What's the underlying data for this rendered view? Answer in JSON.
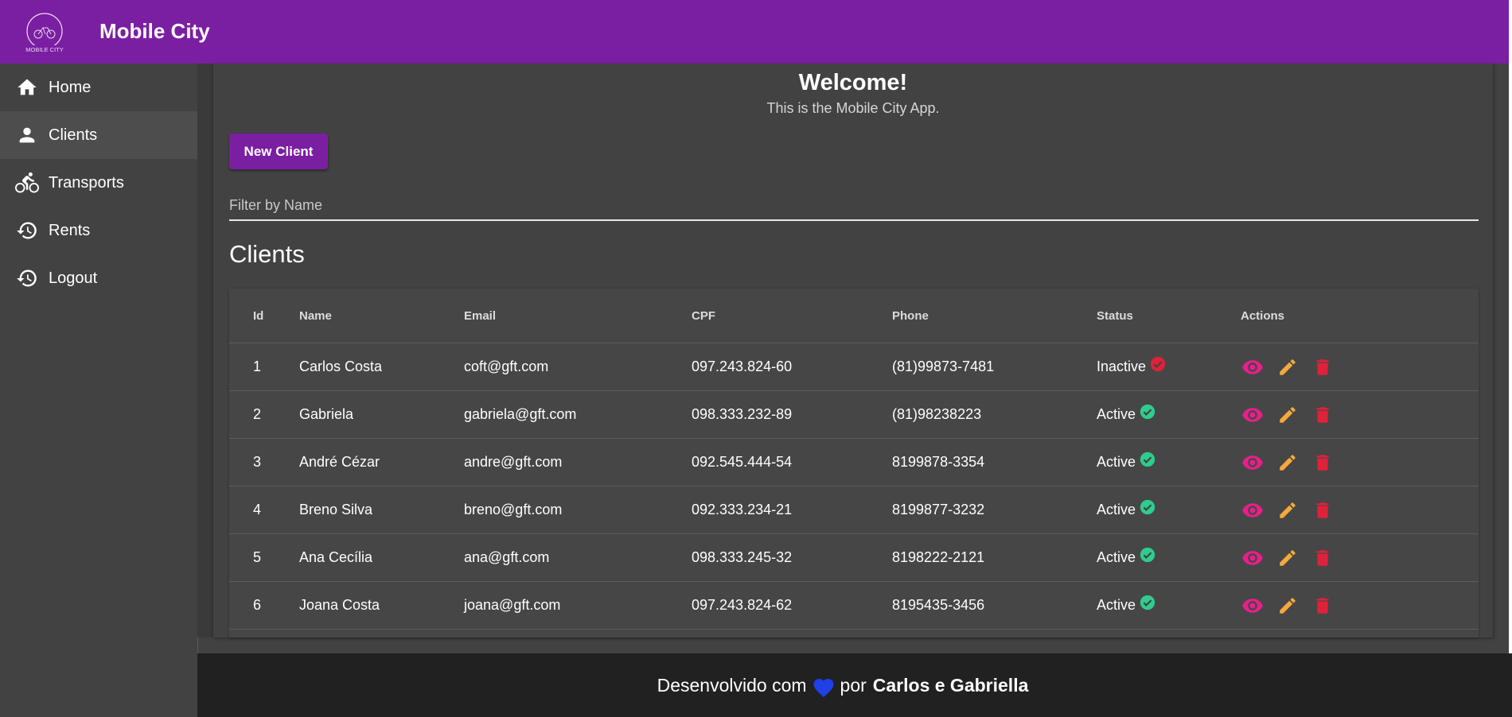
{
  "app": {
    "title": "Mobile City",
    "logo_text": "MOBILE CITY"
  },
  "sidebar": {
    "items": [
      {
        "label": "Home",
        "icon": "home-icon"
      },
      {
        "label": "Clients",
        "icon": "person-icon",
        "active": true
      },
      {
        "label": "Transports",
        "icon": "bicycle-icon"
      },
      {
        "label": "Rents",
        "icon": "history-icon"
      },
      {
        "label": "Logout",
        "icon": "history-icon"
      }
    ]
  },
  "main": {
    "welcome_title": "Welcome!",
    "welcome_subtitle": "This is the Mobile City App.",
    "new_client_label": "New Client",
    "filter_placeholder": "Filter by Name",
    "section_title": "Clients"
  },
  "table": {
    "headers": [
      "Id",
      "Name",
      "Email",
      "CPF",
      "Phone",
      "Status",
      "Actions"
    ],
    "rows": [
      {
        "id": "1",
        "name": "Carlos Costa",
        "email": "coft@gft.com",
        "cpf": "097.243.824-60",
        "phone": "(81)99873-7481",
        "status": "Inactive"
      },
      {
        "id": "2",
        "name": "Gabriela",
        "email": "gabriela@gft.com",
        "cpf": "098.333.232-89",
        "phone": "(81)98238223",
        "status": "Active"
      },
      {
        "id": "3",
        "name": "André Cézar",
        "email": "andre@gft.com",
        "cpf": "092.545.444-54",
        "phone": "8199878-3354",
        "status": "Active"
      },
      {
        "id": "4",
        "name": "Breno Silva",
        "email": "breno@gft.com",
        "cpf": "092.333.234-21",
        "phone": "8199877-3232",
        "status": "Active"
      },
      {
        "id": "5",
        "name": "Ana Cecília",
        "email": "ana@gft.com",
        "cpf": "098.333.245-32",
        "phone": "8198222-2121",
        "status": "Active"
      },
      {
        "id": "6",
        "name": "Joana Costa",
        "email": "joana@gft.com",
        "cpf": "097.243.824-62",
        "phone": "8195435-3456",
        "status": "Active"
      }
    ]
  },
  "footer": {
    "prefix": "Desenvolvido com",
    "middle": "por",
    "authors": "Carlos e Gabriella"
  },
  "colors": {
    "primary": "#7b1fa2",
    "active_status": "#2ecc8f",
    "inactive_status": "#e0213a",
    "view_action": "#e91e8c",
    "edit_action": "#f5a93b",
    "delete_action": "#e0213a",
    "heart": "#1e40e6"
  }
}
